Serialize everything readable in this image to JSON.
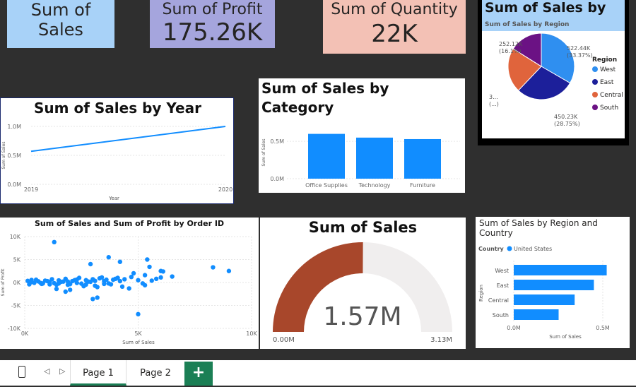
{
  "kpis": {
    "sales": {
      "title_line1": "Sum of",
      "title_line2": "Sales",
      "color": "#a8d2f8"
    },
    "profit": {
      "title": "Sum of Profit",
      "value": "175.26K",
      "color": "#a5a5dd"
    },
    "quantity": {
      "title": "Sum of Quantity",
      "value": "22K",
      "color": "#f3c1b5"
    }
  },
  "region_pie": {
    "title": "Sum of Sales by",
    "subtitle": "Sum of Sales by Region",
    "legend_title": "Region",
    "chart_data": {
      "type": "pie",
      "slices": [
        {
          "name": "West",
          "value": 522.44,
          "label": "522.44K",
          "pct": "(33.37%)",
          "color": "#2f8ff0"
        },
        {
          "name": "East",
          "value": 450.23,
          "label": "450.23K",
          "pct": "(28.75%)",
          "color": "#1c1f9a"
        },
        {
          "name": "Central",
          "value": 341.5,
          "label": "3...",
          "pct": "(...)",
          "color": "#e0643c"
        },
        {
          "name": "South",
          "value": 252.12,
          "label": "252.12K",
          "pct": "(16.1%)",
          "color": "#6b1284"
        }
      ]
    }
  },
  "year_line": {
    "chart_data": {
      "type": "line",
      "title": "Sum of Sales by Year",
      "xlabel": "Year",
      "ylabel": "Sum of Sales",
      "x": [
        "2019",
        "2020"
      ],
      "values": [
        0.57,
        1.0
      ],
      "yticks": [
        "0.0M",
        "0.5M",
        "1.0M"
      ],
      "ylim": [
        0,
        1.0
      ],
      "color": "#118dff"
    }
  },
  "category_bar": {
    "chart_data": {
      "type": "bar",
      "title_line1": "Sum of Sales by",
      "title_line2": "Category",
      "ylabel": "Sum of Sales",
      "categories": [
        "Office Supplies",
        "Technology",
        "Furniture"
      ],
      "values": [
        0.6,
        0.55,
        0.53
      ],
      "yticks": [
        "0.0M",
        "0.5M"
      ],
      "ylim": [
        0,
        0.7
      ],
      "color": "#118dff"
    }
  },
  "scatter": {
    "chart_data": {
      "type": "scatter",
      "title": "Sum of Sales and Sum of Profit by Order ID",
      "xlabel": "Sum of Sales",
      "ylabel": "Sum of Profit",
      "xticks": [
        "0K",
        "5K",
        "10K"
      ],
      "yticks": [
        "10K",
        "5K",
        "0K",
        "-5K",
        "-10K"
      ],
      "xlim": [
        0,
        10000
      ],
      "ylim": [
        -10000,
        10000
      ],
      "color": "#118dff",
      "points": [
        [
          130,
          350
        ],
        [
          300,
          550
        ],
        [
          420,
          -80
        ],
        [
          600,
          250
        ],
        [
          750,
          -300
        ],
        [
          900,
          400
        ],
        [
          1100,
          100
        ],
        [
          1300,
          -150
        ],
        [
          1500,
          450
        ],
        [
          1700,
          200
        ],
        [
          1900,
          -500
        ],
        [
          2100,
          300
        ],
        [
          2300,
          650
        ],
        [
          2500,
          -250
        ],
        [
          2700,
          500
        ],
        [
          2900,
          150
        ],
        [
          3100,
          -700
        ],
        [
          3300,
          900
        ],
        [
          3500,
          300
        ],
        [
          3700,
          -200
        ],
        [
          3900,
          600
        ],
        [
          4100,
          1000
        ],
        [
          4400,
          700
        ],
        [
          4700,
          1200
        ],
        [
          5000,
          500
        ],
        [
          5300,
          -600
        ],
        [
          5600,
          400
        ],
        [
          6000,
          1100
        ],
        [
          6500,
          1300
        ],
        [
          200,
          -400
        ],
        [
          500,
          600
        ],
        [
          800,
          -200
        ],
        [
          1000,
          300
        ],
        [
          1200,
          700
        ],
        [
          1400,
          -500
        ],
        [
          1600,
          150
        ],
        [
          1800,
          800
        ],
        [
          2000,
          -350
        ],
        [
          2200,
          500
        ],
        [
          2400,
          1000
        ],
        [
          2600,
          -800
        ],
        [
          2800,
          200
        ],
        [
          3000,
          700
        ],
        [
          3200,
          -1000
        ],
        [
          3400,
          1100
        ],
        [
          3600,
          600
        ],
        [
          3800,
          -400
        ],
        [
          4000,
          800
        ],
        [
          4200,
          300
        ],
        [
          4600,
          -1300
        ],
        [
          300,
          100
        ],
        [
          700,
          -100
        ],
        [
          1100,
          -400
        ],
        [
          1500,
          -200
        ],
        [
          1900,
          200
        ],
        [
          2300,
          -100
        ],
        [
          2700,
          -450
        ],
        [
          3100,
          350
        ],
        [
          3500,
          -300
        ],
        [
          4300,
          -900
        ],
        [
          5200,
          -200
        ],
        [
          5800,
          800
        ],
        [
          1300,
          8800
        ],
        [
          3700,
          5500
        ],
        [
          2900,
          4000
        ],
        [
          4200,
          4500
        ],
        [
          5400,
          5000
        ],
        [
          5500,
          3400
        ],
        [
          6000,
          2500
        ],
        [
          6100,
          2400
        ],
        [
          8300,
          3300
        ],
        [
          9000,
          2500
        ],
        [
          3000,
          -3600
        ],
        [
          3200,
          -3300
        ],
        [
          1800,
          -2000
        ],
        [
          1400,
          -1400
        ],
        [
          2000,
          -1600
        ],
        [
          5000,
          -6900
        ],
        [
          5300,
          1600
        ],
        [
          4800,
          2000
        ]
      ]
    }
  },
  "gauge": {
    "chart_data": {
      "type": "gauge",
      "title": "Sum of Sales",
      "value": 1.57,
      "value_label": "1.57M",
      "min_label": "0.00M",
      "max_label": "3.13M",
      "min": 0,
      "max": 3.13,
      "fill_color": "#a8472b",
      "track_color": "#f0eeee"
    }
  },
  "region_bar": {
    "chart_data": {
      "type": "bar",
      "orientation": "horizontal",
      "title": "Sum of Sales by Region and Country",
      "legend_title": "Country",
      "series_name": "United States",
      "ylabel": "Region",
      "xlabel": "Sum of Sales",
      "categories": [
        "West",
        "East",
        "Central",
        "South"
      ],
      "values": [
        0.522,
        0.45,
        0.342,
        0.252
      ],
      "xticks": [
        "0.0M",
        "0.5M"
      ],
      "xlim": [
        0,
        0.5
      ],
      "color": "#118dff"
    }
  },
  "tabs": {
    "page1": "Page 1",
    "page2": "Page 2",
    "add": "+"
  }
}
